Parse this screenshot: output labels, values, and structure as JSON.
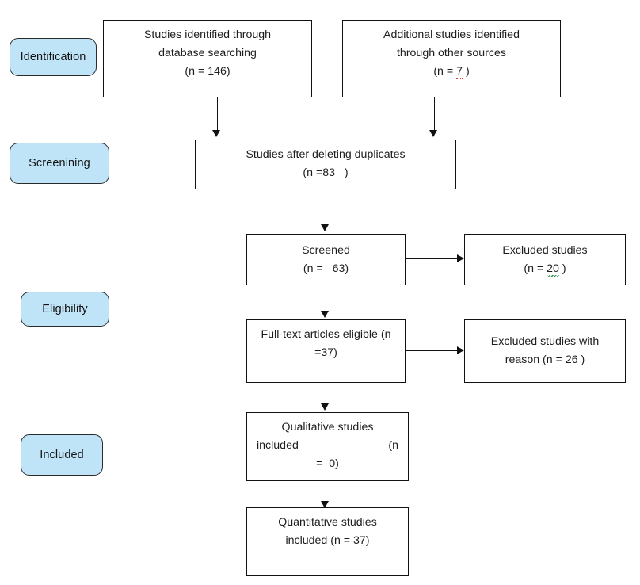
{
  "diagram": {
    "title": "PRISMA study selection flow diagram",
    "colors": {
      "pill_fill": "#bfe3f7",
      "pill_border": "#2b2b2b",
      "box_fill": "#ffffff",
      "box_border": "#111111",
      "connector": "#111111",
      "spellcheck_red": "#e03a3a",
      "grammarcheck_green": "#2f8f46"
    }
  },
  "stages": [
    {
      "id": "identification",
      "label": "Identification"
    },
    {
      "id": "screening",
      "label": "Screenining"
    },
    {
      "id": "eligibility",
      "label": "Eligibility"
    },
    {
      "id": "included",
      "label": "Included"
    }
  ],
  "boxes": {
    "db_search": {
      "line1": "Studies identified through",
      "line2": "database searching",
      "line3": "(n = 146)"
    },
    "other_sources": {
      "line1": "Additional studies identified",
      "line2": "through other sources",
      "line3_a": "(n = ",
      "line3_n": "7",
      "line3_b": " )"
    },
    "after_duplicates": {
      "line1": "Studies after deleting duplicates",
      "line2": "(n =83   )"
    },
    "screened": {
      "line1": "Screened",
      "line2": "(n =   63)"
    },
    "excluded_screened": {
      "line1": "Excluded studies",
      "line2_a": "(n = ",
      "line2_n": "20",
      "line2_b": " )"
    },
    "fulltext": {
      "line1": "Full-text articles eligible (n",
      "line2": "=37)"
    },
    "excluded_reason": {
      "line1": "Excluded studies with",
      "line2": "reason (n = 26 )"
    },
    "qualitative": {
      "line1": "Qualitative studies",
      "line2_left": "included",
      "line2_right": "(n",
      "line3": "=  0)"
    },
    "quantitative": {
      "line1": "Quantitative studies",
      "line2": "included (n = 37)"
    }
  },
  "counts": {
    "database_searching": 146,
    "other_sources": 7,
    "after_duplicates": 83,
    "screened": 63,
    "excluded_after_screening": 20,
    "fulltext_eligible": 37,
    "excluded_with_reason": 26,
    "qualitative_included": 0,
    "quantitative_included": 37
  }
}
